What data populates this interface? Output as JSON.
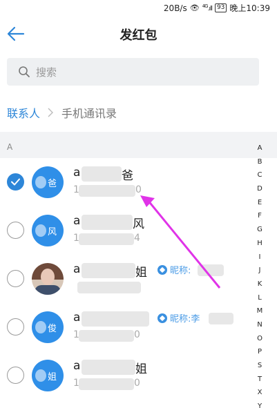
{
  "status_bar": {
    "speed": "20B/s",
    "network": "4G",
    "battery": "93",
    "time": "晚上10:39"
  },
  "nav": {
    "title": "发红包"
  },
  "search": {
    "placeholder": "搜索"
  },
  "breadcrumb": {
    "contacts": "联系人",
    "phone_contacts": "手机通讯录"
  },
  "section": {
    "letter": "A"
  },
  "contacts": [
    {
      "checked": true,
      "avatar_type": "initial",
      "avatar_char": "爸",
      "name_prefix": "a",
      "name_suffix": "爸",
      "phone_prefix": "1",
      "phone_suffix": "0",
      "nickname_label": ""
    },
    {
      "checked": false,
      "avatar_type": "initial",
      "avatar_char": "风",
      "name_prefix": "a",
      "name_suffix": "风",
      "phone_prefix": "1",
      "phone_suffix": "4",
      "nickname_label": ""
    },
    {
      "checked": false,
      "avatar_type": "photo",
      "avatar_char": "",
      "name_prefix": "a",
      "name_suffix": "姐",
      "phone_prefix": "",
      "phone_suffix": "",
      "nickname_label": "昵称:"
    },
    {
      "checked": false,
      "avatar_type": "initial",
      "avatar_char": "俊",
      "name_prefix": "a",
      "name_suffix": "",
      "phone_prefix": "1",
      "phone_suffix": "0",
      "nickname_label": "昵称:李"
    },
    {
      "checked": false,
      "avatar_type": "initial",
      "avatar_char": "姐",
      "name_prefix": "a",
      "name_suffix": "姐",
      "phone_prefix": "1",
      "phone_suffix": "0",
      "nickname_label": ""
    }
  ],
  "alphabet_index": [
    "A",
    "B",
    "C",
    "D",
    "E",
    "F",
    "G",
    "H",
    "I",
    "J",
    "K",
    "L",
    "M",
    "N",
    "O",
    "P",
    "S",
    "T",
    "X",
    "Y"
  ],
  "colors": {
    "accent": "#2d86d8",
    "avatar": "#2f8fe8",
    "annotation_arrow": "#e033e8"
  },
  "icons": {
    "back": "back-arrow-icon",
    "search": "search-icon",
    "breadcrumb_separator": "chevron-right-icon",
    "check": "check-icon",
    "nickname": "diamond-badge-icon"
  }
}
